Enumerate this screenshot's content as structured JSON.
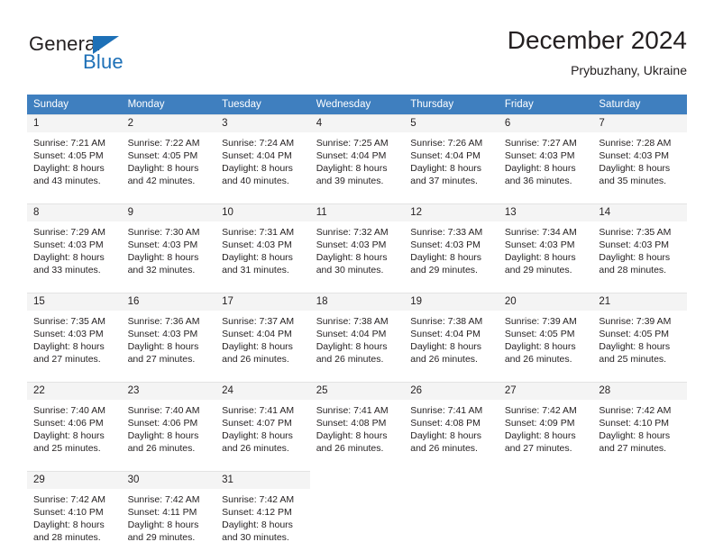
{
  "brand": {
    "name_part1": "General",
    "name_part2": "Blue",
    "triangle_icon": "triangle-icon",
    "accent_color": "#1d70b7"
  },
  "header": {
    "title": "December 2024",
    "location": "Prybuzhany, Ukraine"
  },
  "theme": {
    "header_row_bg": "#3f7fbf",
    "day_number_bg": "#f4f4f4",
    "text_color": "#231f20",
    "grid_line": "#e3e3e3"
  },
  "calendar": {
    "weekday_headers": [
      "Sunday",
      "Monday",
      "Tuesday",
      "Wednesday",
      "Thursday",
      "Friday",
      "Saturday"
    ],
    "weeks": [
      [
        {
          "day": "1",
          "sunrise": "Sunrise: 7:21 AM",
          "sunset": "Sunset: 4:05 PM",
          "daylight1": "Daylight: 8 hours",
          "daylight2": "and 43 minutes."
        },
        {
          "day": "2",
          "sunrise": "Sunrise: 7:22 AM",
          "sunset": "Sunset: 4:05 PM",
          "daylight1": "Daylight: 8 hours",
          "daylight2": "and 42 minutes."
        },
        {
          "day": "3",
          "sunrise": "Sunrise: 7:24 AM",
          "sunset": "Sunset: 4:04 PM",
          "daylight1": "Daylight: 8 hours",
          "daylight2": "and 40 minutes."
        },
        {
          "day": "4",
          "sunrise": "Sunrise: 7:25 AM",
          "sunset": "Sunset: 4:04 PM",
          "daylight1": "Daylight: 8 hours",
          "daylight2": "and 39 minutes."
        },
        {
          "day": "5",
          "sunrise": "Sunrise: 7:26 AM",
          "sunset": "Sunset: 4:04 PM",
          "daylight1": "Daylight: 8 hours",
          "daylight2": "and 37 minutes."
        },
        {
          "day": "6",
          "sunrise": "Sunrise: 7:27 AM",
          "sunset": "Sunset: 4:03 PM",
          "daylight1": "Daylight: 8 hours",
          "daylight2": "and 36 minutes."
        },
        {
          "day": "7",
          "sunrise": "Sunrise: 7:28 AM",
          "sunset": "Sunset: 4:03 PM",
          "daylight1": "Daylight: 8 hours",
          "daylight2": "and 35 minutes."
        }
      ],
      [
        {
          "day": "8",
          "sunrise": "Sunrise: 7:29 AM",
          "sunset": "Sunset: 4:03 PM",
          "daylight1": "Daylight: 8 hours",
          "daylight2": "and 33 minutes."
        },
        {
          "day": "9",
          "sunrise": "Sunrise: 7:30 AM",
          "sunset": "Sunset: 4:03 PM",
          "daylight1": "Daylight: 8 hours",
          "daylight2": "and 32 minutes."
        },
        {
          "day": "10",
          "sunrise": "Sunrise: 7:31 AM",
          "sunset": "Sunset: 4:03 PM",
          "daylight1": "Daylight: 8 hours",
          "daylight2": "and 31 minutes."
        },
        {
          "day": "11",
          "sunrise": "Sunrise: 7:32 AM",
          "sunset": "Sunset: 4:03 PM",
          "daylight1": "Daylight: 8 hours",
          "daylight2": "and 30 minutes."
        },
        {
          "day": "12",
          "sunrise": "Sunrise: 7:33 AM",
          "sunset": "Sunset: 4:03 PM",
          "daylight1": "Daylight: 8 hours",
          "daylight2": "and 29 minutes."
        },
        {
          "day": "13",
          "sunrise": "Sunrise: 7:34 AM",
          "sunset": "Sunset: 4:03 PM",
          "daylight1": "Daylight: 8 hours",
          "daylight2": "and 29 minutes."
        },
        {
          "day": "14",
          "sunrise": "Sunrise: 7:35 AM",
          "sunset": "Sunset: 4:03 PM",
          "daylight1": "Daylight: 8 hours",
          "daylight2": "and 28 minutes."
        }
      ],
      [
        {
          "day": "15",
          "sunrise": "Sunrise: 7:35 AM",
          "sunset": "Sunset: 4:03 PM",
          "daylight1": "Daylight: 8 hours",
          "daylight2": "and 27 minutes."
        },
        {
          "day": "16",
          "sunrise": "Sunrise: 7:36 AM",
          "sunset": "Sunset: 4:03 PM",
          "daylight1": "Daylight: 8 hours",
          "daylight2": "and 27 minutes."
        },
        {
          "day": "17",
          "sunrise": "Sunrise: 7:37 AM",
          "sunset": "Sunset: 4:04 PM",
          "daylight1": "Daylight: 8 hours",
          "daylight2": "and 26 minutes."
        },
        {
          "day": "18",
          "sunrise": "Sunrise: 7:38 AM",
          "sunset": "Sunset: 4:04 PM",
          "daylight1": "Daylight: 8 hours",
          "daylight2": "and 26 minutes."
        },
        {
          "day": "19",
          "sunrise": "Sunrise: 7:38 AM",
          "sunset": "Sunset: 4:04 PM",
          "daylight1": "Daylight: 8 hours",
          "daylight2": "and 26 minutes."
        },
        {
          "day": "20",
          "sunrise": "Sunrise: 7:39 AM",
          "sunset": "Sunset: 4:05 PM",
          "daylight1": "Daylight: 8 hours",
          "daylight2": "and 26 minutes."
        },
        {
          "day": "21",
          "sunrise": "Sunrise: 7:39 AM",
          "sunset": "Sunset: 4:05 PM",
          "daylight1": "Daylight: 8 hours",
          "daylight2": "and 25 minutes."
        }
      ],
      [
        {
          "day": "22",
          "sunrise": "Sunrise: 7:40 AM",
          "sunset": "Sunset: 4:06 PM",
          "daylight1": "Daylight: 8 hours",
          "daylight2": "and 25 minutes."
        },
        {
          "day": "23",
          "sunrise": "Sunrise: 7:40 AM",
          "sunset": "Sunset: 4:06 PM",
          "daylight1": "Daylight: 8 hours",
          "daylight2": "and 26 minutes."
        },
        {
          "day": "24",
          "sunrise": "Sunrise: 7:41 AM",
          "sunset": "Sunset: 4:07 PM",
          "daylight1": "Daylight: 8 hours",
          "daylight2": "and 26 minutes."
        },
        {
          "day": "25",
          "sunrise": "Sunrise: 7:41 AM",
          "sunset": "Sunset: 4:08 PM",
          "daylight1": "Daylight: 8 hours",
          "daylight2": "and 26 minutes."
        },
        {
          "day": "26",
          "sunrise": "Sunrise: 7:41 AM",
          "sunset": "Sunset: 4:08 PM",
          "daylight1": "Daylight: 8 hours",
          "daylight2": "and 26 minutes."
        },
        {
          "day": "27",
          "sunrise": "Sunrise: 7:42 AM",
          "sunset": "Sunset: 4:09 PM",
          "daylight1": "Daylight: 8 hours",
          "daylight2": "and 27 minutes."
        },
        {
          "day": "28",
          "sunrise": "Sunrise: 7:42 AM",
          "sunset": "Sunset: 4:10 PM",
          "daylight1": "Daylight: 8 hours",
          "daylight2": "and 27 minutes."
        }
      ],
      [
        {
          "day": "29",
          "sunrise": "Sunrise: 7:42 AM",
          "sunset": "Sunset: 4:10 PM",
          "daylight1": "Daylight: 8 hours",
          "daylight2": "and 28 minutes."
        },
        {
          "day": "30",
          "sunrise": "Sunrise: 7:42 AM",
          "sunset": "Sunset: 4:11 PM",
          "daylight1": "Daylight: 8 hours",
          "daylight2": "and 29 minutes."
        },
        {
          "day": "31",
          "sunrise": "Sunrise: 7:42 AM",
          "sunset": "Sunset: 4:12 PM",
          "daylight1": "Daylight: 8 hours",
          "daylight2": "and 30 minutes."
        },
        {
          "day": "",
          "sunrise": "",
          "sunset": "",
          "daylight1": "",
          "daylight2": ""
        },
        {
          "day": "",
          "sunrise": "",
          "sunset": "",
          "daylight1": "",
          "daylight2": ""
        },
        {
          "day": "",
          "sunrise": "",
          "sunset": "",
          "daylight1": "",
          "daylight2": ""
        },
        {
          "day": "",
          "sunrise": "",
          "sunset": "",
          "daylight1": "",
          "daylight2": ""
        }
      ]
    ]
  }
}
